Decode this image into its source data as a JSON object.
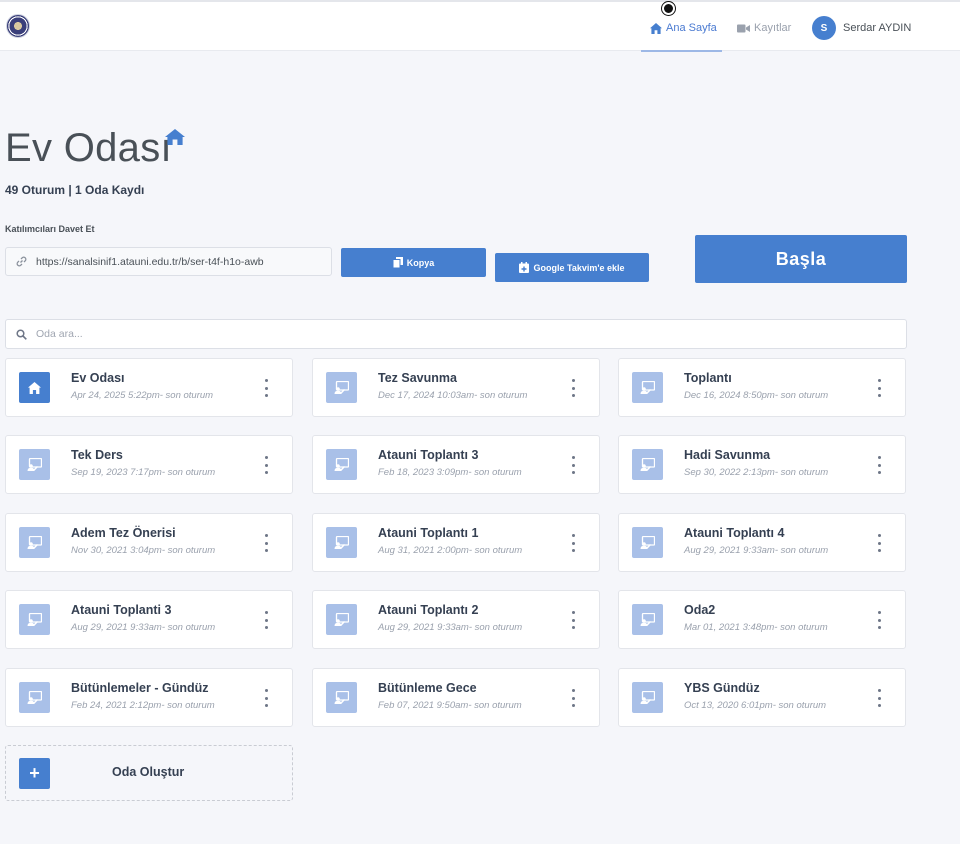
{
  "header": {
    "nav_home_label": "Ana Sayfa",
    "nav_recordings_label": "Kayıtlar",
    "user_initial": "S",
    "user_name": "Serdar AYDIN"
  },
  "main": {
    "title": "Ev Odası",
    "stats": "49 Oturum | 1 Oda Kaydı",
    "invite_label": "Katılımcıları Davet Et",
    "invite_url": "https://sanalsinif1.atauni.edu.tr/b/ser-t4f-h1o-awb",
    "copy_label": "Kopya",
    "gcal_label": "Google Takvim'e ekle",
    "start_label": "Başla",
    "search_placeholder": "Oda ara...",
    "create_room_label": "Oda Oluştur"
  },
  "rooms": [
    {
      "name": "Ev Odası",
      "date": "Apr 24, 2025 5:22pm- son oturum",
      "icon": "home-icon"
    },
    {
      "name": "Tez Savunma",
      "date": "Dec 17, 2024 10:03am- son oturum",
      "icon": "presentation-icon"
    },
    {
      "name": "Toplantı",
      "date": "Dec 16, 2024 8:50pm- son oturum",
      "icon": "presentation-icon"
    },
    {
      "name": "Tek Ders",
      "date": "Sep 19, 2023 7:17pm- son oturum",
      "icon": "presentation-icon"
    },
    {
      "name": "Atauni Toplantı 3",
      "date": "Feb 18, 2023 3:09pm- son oturum",
      "icon": "presentation-icon"
    },
    {
      "name": "Hadi Savunma",
      "date": "Sep 30, 2022 2:13pm- son oturum",
      "icon": "presentation-icon"
    },
    {
      "name": "Adem Tez Önerisi",
      "date": "Nov 30, 2021 3:04pm- son oturum",
      "icon": "presentation-icon"
    },
    {
      "name": "Atauni Toplantı 1",
      "date": "Aug 31, 2021 2:00pm- son oturum",
      "icon": "presentation-icon"
    },
    {
      "name": "Atauni Toplantı 4",
      "date": "Aug 29, 2021 9:33am- son oturum",
      "icon": "presentation-icon"
    },
    {
      "name": "Atauni Toplanti 3",
      "date": "Aug 29, 2021 9:33am- son oturum",
      "icon": "presentation-icon"
    },
    {
      "name": "Atauni Toplantı 2",
      "date": "Aug 29, 2021 9:33am- son oturum",
      "icon": "presentation-icon"
    },
    {
      "name": "Oda2",
      "date": "Mar 01, 2021 3:48pm- son oturum",
      "icon": "presentation-icon"
    },
    {
      "name": "Bütünlemeler - Gündüz",
      "date": "Feb 24, 2021 2:12pm- son oturum",
      "icon": "presentation-icon"
    },
    {
      "name": "Bütünleme Gece",
      "date": "Feb 07, 2021 9:50am- son oturum",
      "icon": "presentation-icon"
    },
    {
      "name": "YBS Gündüz",
      "date": "Oct 13, 2020 6:01pm- son oturum",
      "icon": "presentation-icon"
    }
  ],
  "colors": {
    "accent": "#467fcf",
    "room_icon_bg": "#a9c0e8",
    "page_bg": "#f5f6fa"
  }
}
